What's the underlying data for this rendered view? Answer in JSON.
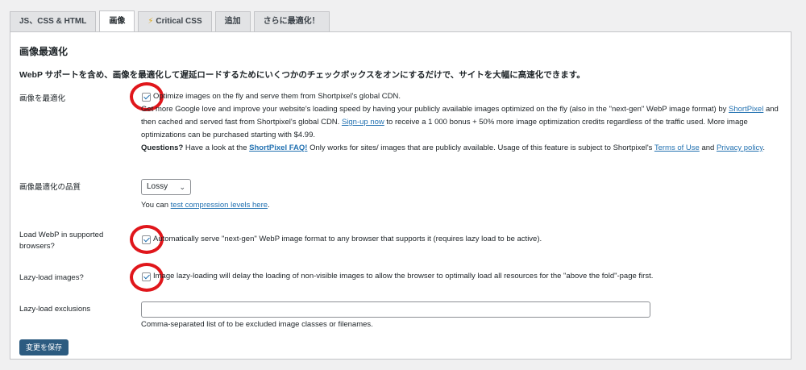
{
  "tabs": [
    {
      "label": "JS、CSS & HTML"
    },
    {
      "label": "画像"
    },
    {
      "label": "Critical CSS"
    },
    {
      "label": "追加"
    },
    {
      "label": "さらに最適化！"
    }
  ],
  "section": {
    "title": "画像最適化",
    "description": "WebP サポートを含め、画像を最適化して遅延ロードするためにいくつかのチェックボックスをオンにするだけで、サイトを大幅に高速化できます。"
  },
  "optimize": {
    "label": "画像を最適化",
    "checkbox_text": "Optimize images on the fly and serve them from Shortpixel's global CDN.",
    "para1_a": "Get more Google love and improve your website's loading speed by having your publicly available images optimized on the fly (also in the \"next-gen\" WebP image format) by",
    "shortpixel_link": "ShortPixel",
    "para1_b": " and then cached and served fast from Shortpixel's global CDN. ",
    "signup_link": "Sign-up now",
    "para1_c": " to receive a 1 000 bonus + 50% more image optimization credits regardless of the traffic used. More image optimizations can be purchased starting with $4.99.",
    "questions_bold": "Questions?",
    "para2_a": " Have a look at the ",
    "faq_link": "ShortPixel FAQ!",
    "para2_b": " Only works for sites/ images that are publicly available. Usage of this feature is subject to Shortpixel's ",
    "terms_link": "Terms of Use",
    "para2_c": " and ",
    "privacy_link": "Privacy policy",
    "para2_d": "."
  },
  "quality": {
    "label": "画像最適化の品質",
    "selected": "Lossy",
    "hint_a": "You can ",
    "hint_link": "test compression levels here",
    "hint_b": "."
  },
  "webp": {
    "label": "Load WebP in supported browsers?",
    "checkbox_text": "Automatically serve \"next-gen\" WebP image format to any browser that supports it (requires lazy load to be active)."
  },
  "lazy": {
    "label": "Lazy-load images?",
    "checkbox_text": "Image lazy-loading will delay the loading of non-visible images to allow the browser to optimally load all resources for the \"above the fold\"-page first."
  },
  "exclusions": {
    "label": "Lazy-load exclusions",
    "value": "",
    "hint": "Comma-separated list of to be excluded image classes or filenames."
  },
  "save_button": "変更を保存",
  "colors": {
    "accent": "#2271b1",
    "button": "#2c5b80",
    "annotation": "#e0161b"
  }
}
